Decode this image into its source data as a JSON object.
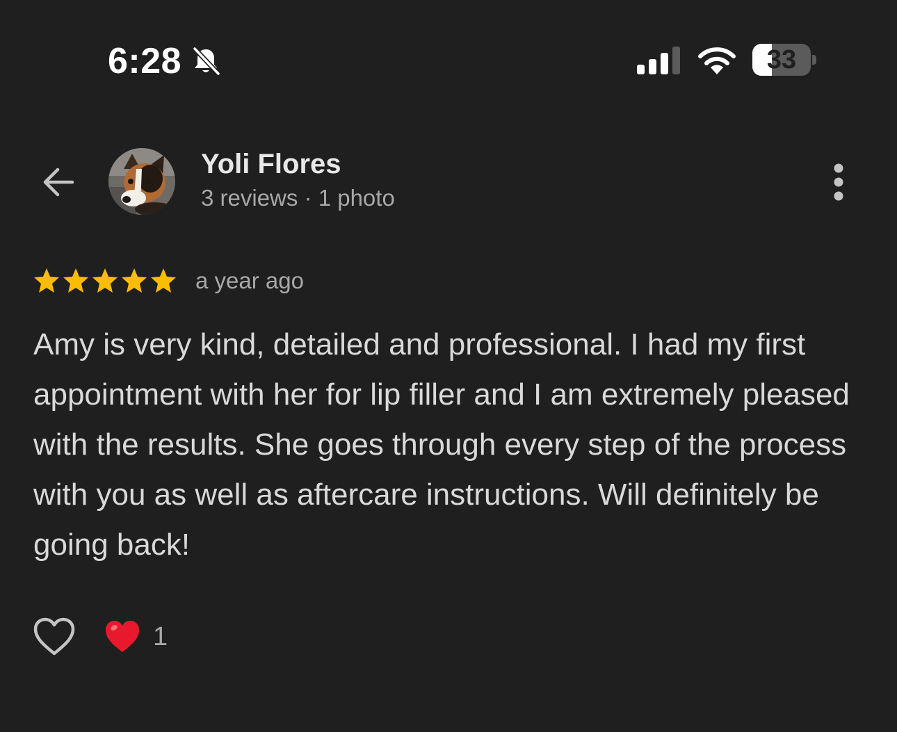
{
  "status_bar": {
    "time": "6:28",
    "silent_icon": "bell-slash-icon",
    "signal_icon": "cellular-signal-icon",
    "wifi_icon": "wifi-icon",
    "battery_level": "33",
    "battery_fraction": 0.33
  },
  "header": {
    "back_icon": "arrow-left-icon",
    "avatar_icon": "dog-avatar",
    "name": "Yoli Flores",
    "meta": "3 reviews · 1 photo",
    "more_icon": "more-vertical-icon"
  },
  "review": {
    "rating": 5,
    "rating_max": 5,
    "star_color": "#fbbc04",
    "date": "a year ago",
    "text": "Amy is very kind, detailed and professional. I had my first appointment with her for lip filler and I am extremely pleased with the results. She goes through every step of the process with you as well as aftercare instructions. Will definitely be going back!"
  },
  "reactions": {
    "like_icon": "heart-outline-icon",
    "reaction_icon": "red-heart-emoji",
    "count": "1",
    "heart_color": "#e8192c"
  }
}
